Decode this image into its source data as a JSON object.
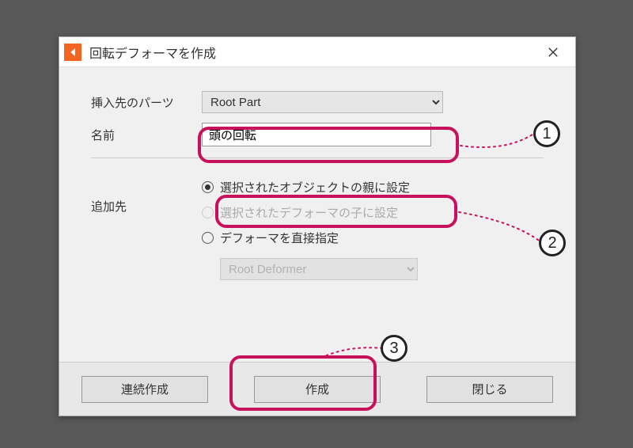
{
  "window": {
    "title": "回転デフォーマを作成"
  },
  "form": {
    "insert_part_label": "挿入先のパーツ",
    "insert_part_value": "Root Part",
    "name_label": "名前",
    "name_value": "頭の回転",
    "target_label": "追加先",
    "radio1": "選択されたオブジェクトの親に設定",
    "radio2": "選択されたデフォーマの子に設定",
    "radio3": "デフォーマを直接指定",
    "deformer_value": "Root Deformer"
  },
  "buttons": {
    "continuous": "連続作成",
    "create": "作成",
    "close": "閉じる"
  },
  "annotations": {
    "n1": "1",
    "n2": "2",
    "n3": "3"
  }
}
